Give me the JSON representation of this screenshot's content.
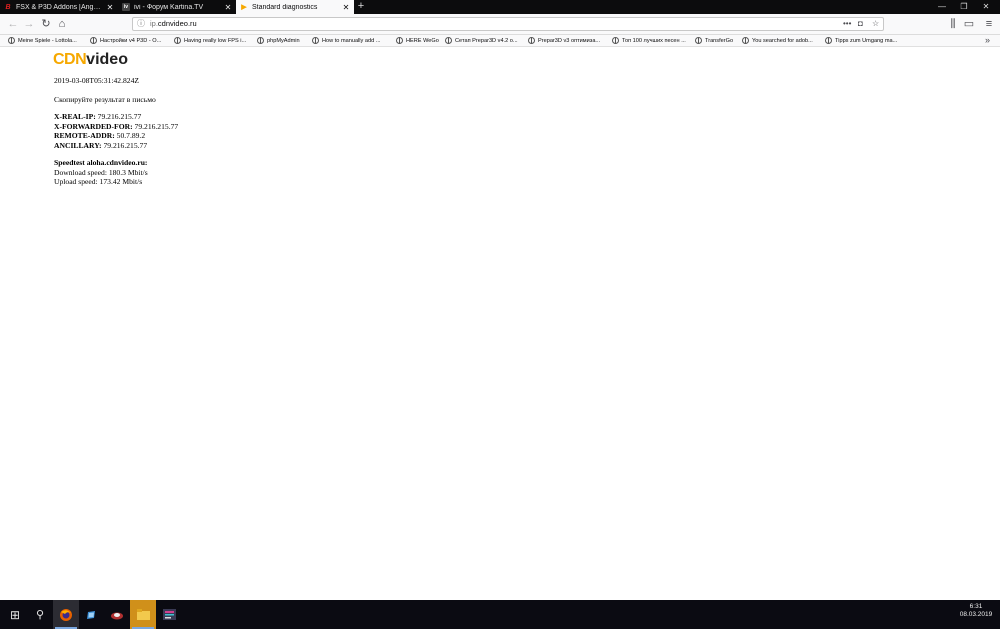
{
  "tabs": [
    {
      "label": "FSX & P3D Addons [Angebote...",
      "icon_char": "B",
      "icon_color": "#e02020"
    },
    {
      "label": "ivi - Форум Kartina.TV",
      "icon_char": "iv",
      "icon_color": "#ffffff"
    },
    {
      "label": "Standard diagnostics",
      "icon_char": "▶",
      "icon_color": "#f6a800",
      "active": true
    }
  ],
  "window_controls": {
    "minimize": "—",
    "restore": "❐",
    "close": "✕"
  },
  "nav": {
    "back": "←",
    "forward": "→",
    "reload": "↻",
    "home": "⌂"
  },
  "url": {
    "prefix": "ip.",
    "host": "cdnvideo.ru"
  },
  "url_icons": {
    "more": "•••",
    "pocket": "◘",
    "star": "☆"
  },
  "toolbar_icons": {
    "library": "⫼",
    "sidebar": "▭",
    "menu": "≡"
  },
  "bookmarks": [
    "Meine Spiele - Lottola...",
    "Настройки v4 P3D - O...",
    "Having really low FPS i...",
    "phpMyAdmin",
    "How to manually add ...",
    "HERE WeGo",
    "Сетап Prepar3D v4.2 o...",
    "Prepar3D v3 оптимиза...",
    "Топ 100 лучших песен ...",
    "TransferGo",
    "You searched for adob...",
    "Tipps zum Umgang ma..."
  ],
  "bookmarks_overflow": "»",
  "page": {
    "logo_cdn": "CDN",
    "logo_video": "video",
    "timestamp": "2019-03-08T05:31:42.824Z",
    "instruction": "Скопируйте результат в письмо",
    "headers": [
      {
        "key": "X-REAL-IP:",
        "value": " 79.216.215.77"
      },
      {
        "key": "X-FORWARDED-FOR:",
        "value": " 79.216.215.77"
      },
      {
        "key": "REMOTE-ADDR:",
        "value": " 50.7.89.2"
      },
      {
        "key": "ANCILLARY:",
        "value": " 79.216.215.77"
      }
    ],
    "speedtest_title": "Speedtest aloha.cdnvideo.ru:",
    "download": "Download speed: 180.3 Mbit/s",
    "upload": "Upload speed: 173.42 Mbit/s"
  },
  "taskbar": {
    "start": "⊞",
    "search": "⚲",
    "apps": [
      "firefox",
      "steam",
      "flight-sim",
      "file-explorer",
      "media-player"
    ],
    "time": "6:31",
    "date": "08.03.2019"
  }
}
